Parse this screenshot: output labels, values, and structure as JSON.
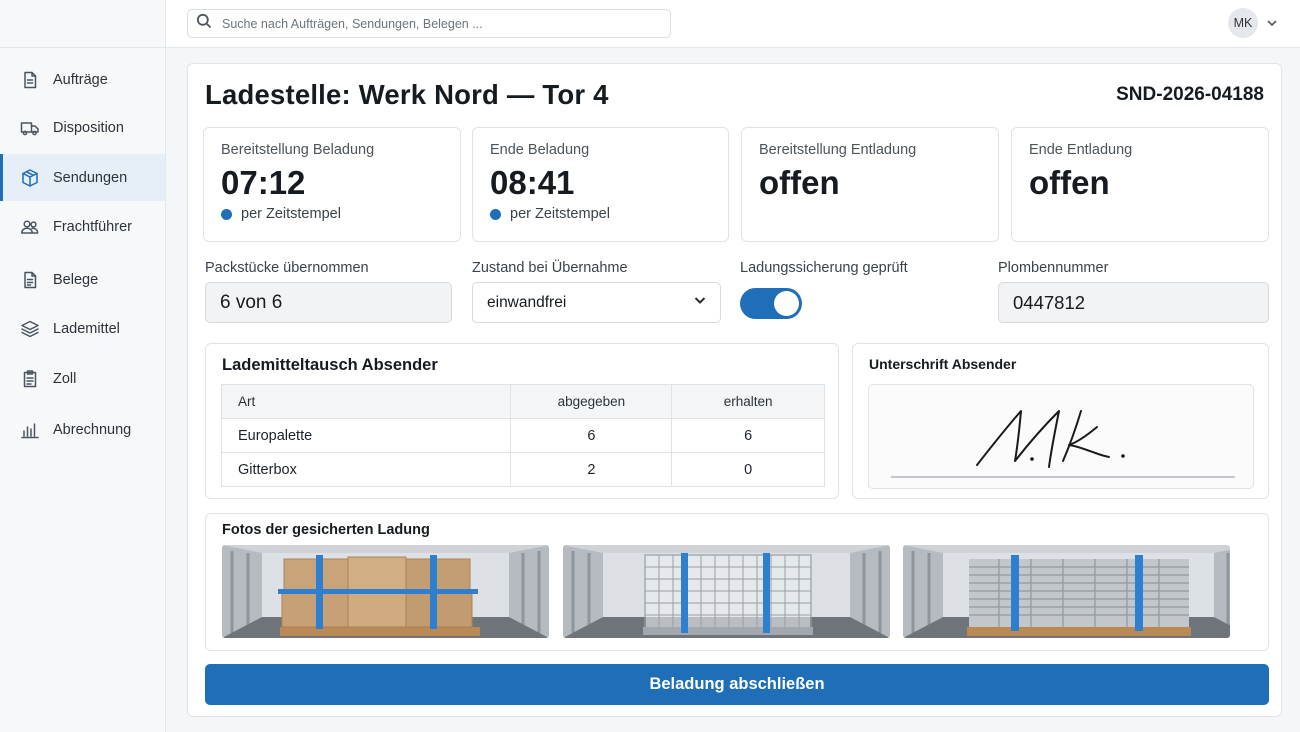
{
  "search": {
    "placeholder": "Suche nach Aufträgen, Sendungen, Belegen ..."
  },
  "user": {
    "initials": "MK"
  },
  "sidebar": {
    "items": [
      {
        "label": "Aufträge",
        "icon": "document-icon"
      },
      {
        "label": "Disposition",
        "icon": "truck-icon"
      },
      {
        "label": "Sendungen",
        "icon": "package-icon",
        "active": true
      },
      {
        "label": "Frachtführer",
        "icon": "users-icon"
      },
      {
        "label": "Belege",
        "icon": "receipt-icon"
      },
      {
        "label": "Lademittel",
        "icon": "layers-icon"
      },
      {
        "label": "Zoll",
        "icon": "clipboard-icon"
      },
      {
        "label": "Abrechnung",
        "icon": "bar-chart-icon"
      }
    ]
  },
  "header": {
    "title": "Ladestelle: Werk Nord — Tor 4",
    "shipment_id": "SND-2026-04188"
  },
  "stats": [
    {
      "label": "Bereitstellung Beladung",
      "value": "07:12",
      "meta": "per Zeitstempel"
    },
    {
      "label": "Ende Beladung",
      "value": "08:41",
      "meta": "per Zeitstempel"
    },
    {
      "label": "Bereitstellung Entladung",
      "value": "offen"
    },
    {
      "label": "Ende Entladung",
      "value": "offen"
    }
  ],
  "form": {
    "packages_label": "Packstücke übernommen",
    "packages_value": "6 von 6",
    "condition_label": "Zustand bei Übernahme",
    "condition_value": "einwandfrei",
    "securing_label": "Ladungssicherung geprüft",
    "securing_checked": true,
    "seal_label": "Plombennummer",
    "seal_value": "0447812"
  },
  "exchange": {
    "title": "Lademitteltausch Absender",
    "columns": [
      "Art",
      "abgegeben",
      "erhalten"
    ],
    "rows": [
      {
        "art": "Europalette",
        "given": "6",
        "received": "6"
      },
      {
        "art": "Gitterbox",
        "given": "2",
        "received": "0"
      }
    ]
  },
  "signature": {
    "title": "Unterschrift Absender",
    "text": "M.k."
  },
  "photos": {
    "title": "Fotos der gesicherten Ladung",
    "items": [
      "photo-cartons-on-pallet",
      "photo-wire-mesh-box",
      "photo-steel-profiles"
    ]
  },
  "actions": {
    "finish_label": "Beladung abschließen"
  },
  "colors": {
    "accent": "#1f6fb8",
    "strap": "#2f7fd0"
  }
}
